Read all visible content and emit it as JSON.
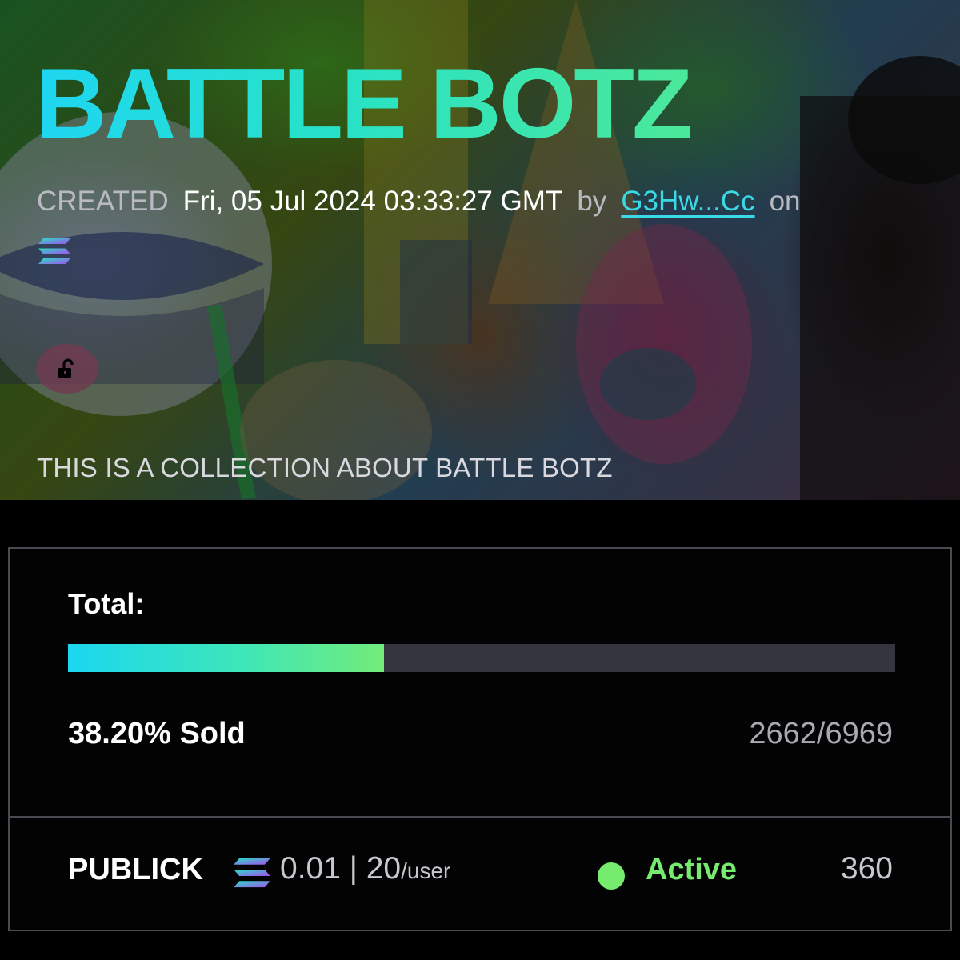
{
  "collection": {
    "title": "BATTLE BOTZ",
    "created_label": "CREATED",
    "created_date": "Fri, 05 Jul 2024 03:33:27 GMT",
    "by_label": "by",
    "creator": "G3Hw...Cc",
    "on_label": "on",
    "chain_icon": "solana-icon",
    "lock_icon": "unlock-icon",
    "description": "THIS IS A COLLECTION ABOUT BATTLE BOTZ"
  },
  "mint": {
    "total_label": "Total:",
    "sold_fraction": 0.382,
    "sold_text": "38.20% Sold",
    "count_text": "2662/6969"
  },
  "phase": {
    "name": "PUBLICK",
    "price": "0.01",
    "separator": "|",
    "limit": "20",
    "limit_unit": "/user",
    "status": "Active",
    "count": "360"
  },
  "colors": {
    "title_gradient_start": "#1fd6f2",
    "title_gradient_end": "#4be89a",
    "link": "#3ad9e6",
    "active": "#76ec6e",
    "progress_track": "#34353e"
  }
}
